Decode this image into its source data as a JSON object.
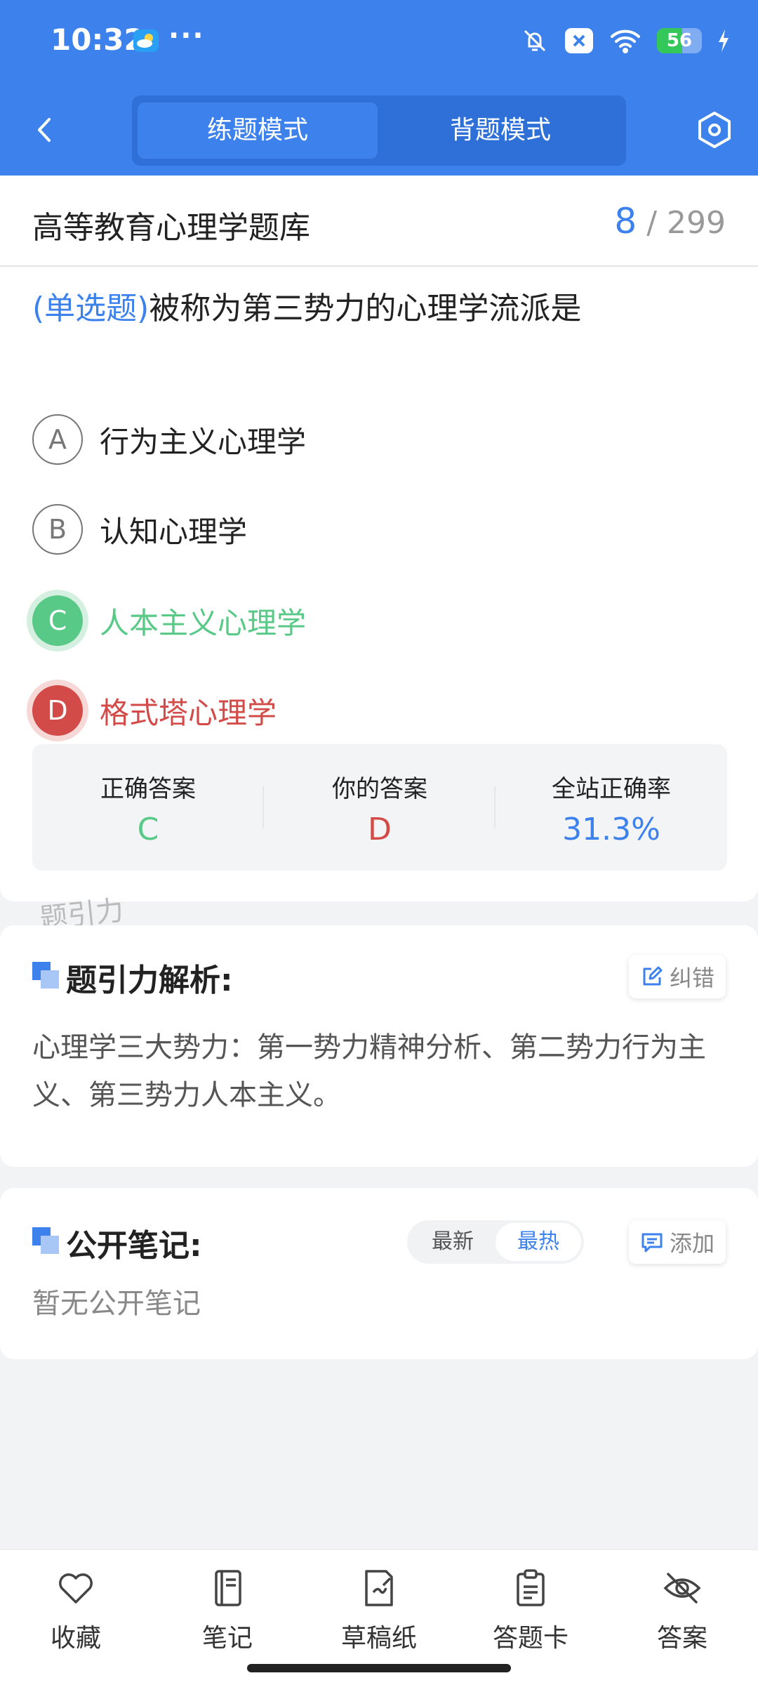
{
  "status_bar": {
    "time": "10:32",
    "overflow": "···",
    "battery_level": "56",
    "battery_percent": 56,
    "icons": [
      "weather-icon",
      "bell-off-icon",
      "notification-x-icon",
      "wifi-icon",
      "battery-icon",
      "charging-icon"
    ]
  },
  "nav": {
    "modes": [
      "练题模式",
      "背题模式"
    ],
    "active_mode": "练题模式",
    "icons": [
      "back-chevron-icon",
      "settings-hexagon-icon"
    ]
  },
  "question_card": {
    "bank_title": "高等教育心理学题库",
    "current_index": "8",
    "total": "/ 299",
    "type": "(单选题)",
    "text": "被称为第三势力的心理学流派是",
    "options": [
      {
        "letter": "A",
        "text": "行为主义心理学",
        "state": "normal"
      },
      {
        "letter": "B",
        "text": "认知心理学",
        "state": "normal"
      },
      {
        "letter": "C",
        "text": "人本主义心理学",
        "state": "correct"
      },
      {
        "letter": "D",
        "text": "格式塔心理学",
        "state": "wrong"
      }
    ],
    "results": {
      "correct_label": "正确答案",
      "correct_value": "C",
      "yours_label": "你的答案",
      "yours_value": "D",
      "rate_label": "全站正确率",
      "rate_value": "31.3%"
    },
    "watermark": "题引力"
  },
  "analysis": {
    "title": "题引力解析:",
    "report_button": "纠错",
    "text": "心理学三大势力：第一势力精神分析、第二势力行为主义、第三势力人本主义。"
  },
  "notes": {
    "title": "公开笔记:",
    "sort_options": [
      "最新",
      "最热"
    ],
    "active_sort": "最热",
    "add_button": "添加",
    "empty_text": "暂无公开笔记"
  },
  "bottom_bar": [
    {
      "label": "收藏",
      "icon": "heart-icon"
    },
    {
      "label": "笔记",
      "icon": "notebook-icon"
    },
    {
      "label": "草稿纸",
      "icon": "scratch-paper-icon"
    },
    {
      "label": "答题卡",
      "icon": "answer-sheet-icon"
    },
    {
      "label": "答案",
      "icon": "eye-off-icon"
    }
  ],
  "colors": {
    "primary": "#3d82ec",
    "correct": "#58c987",
    "wrong": "#d34b48",
    "background": "#f2f3f5"
  }
}
